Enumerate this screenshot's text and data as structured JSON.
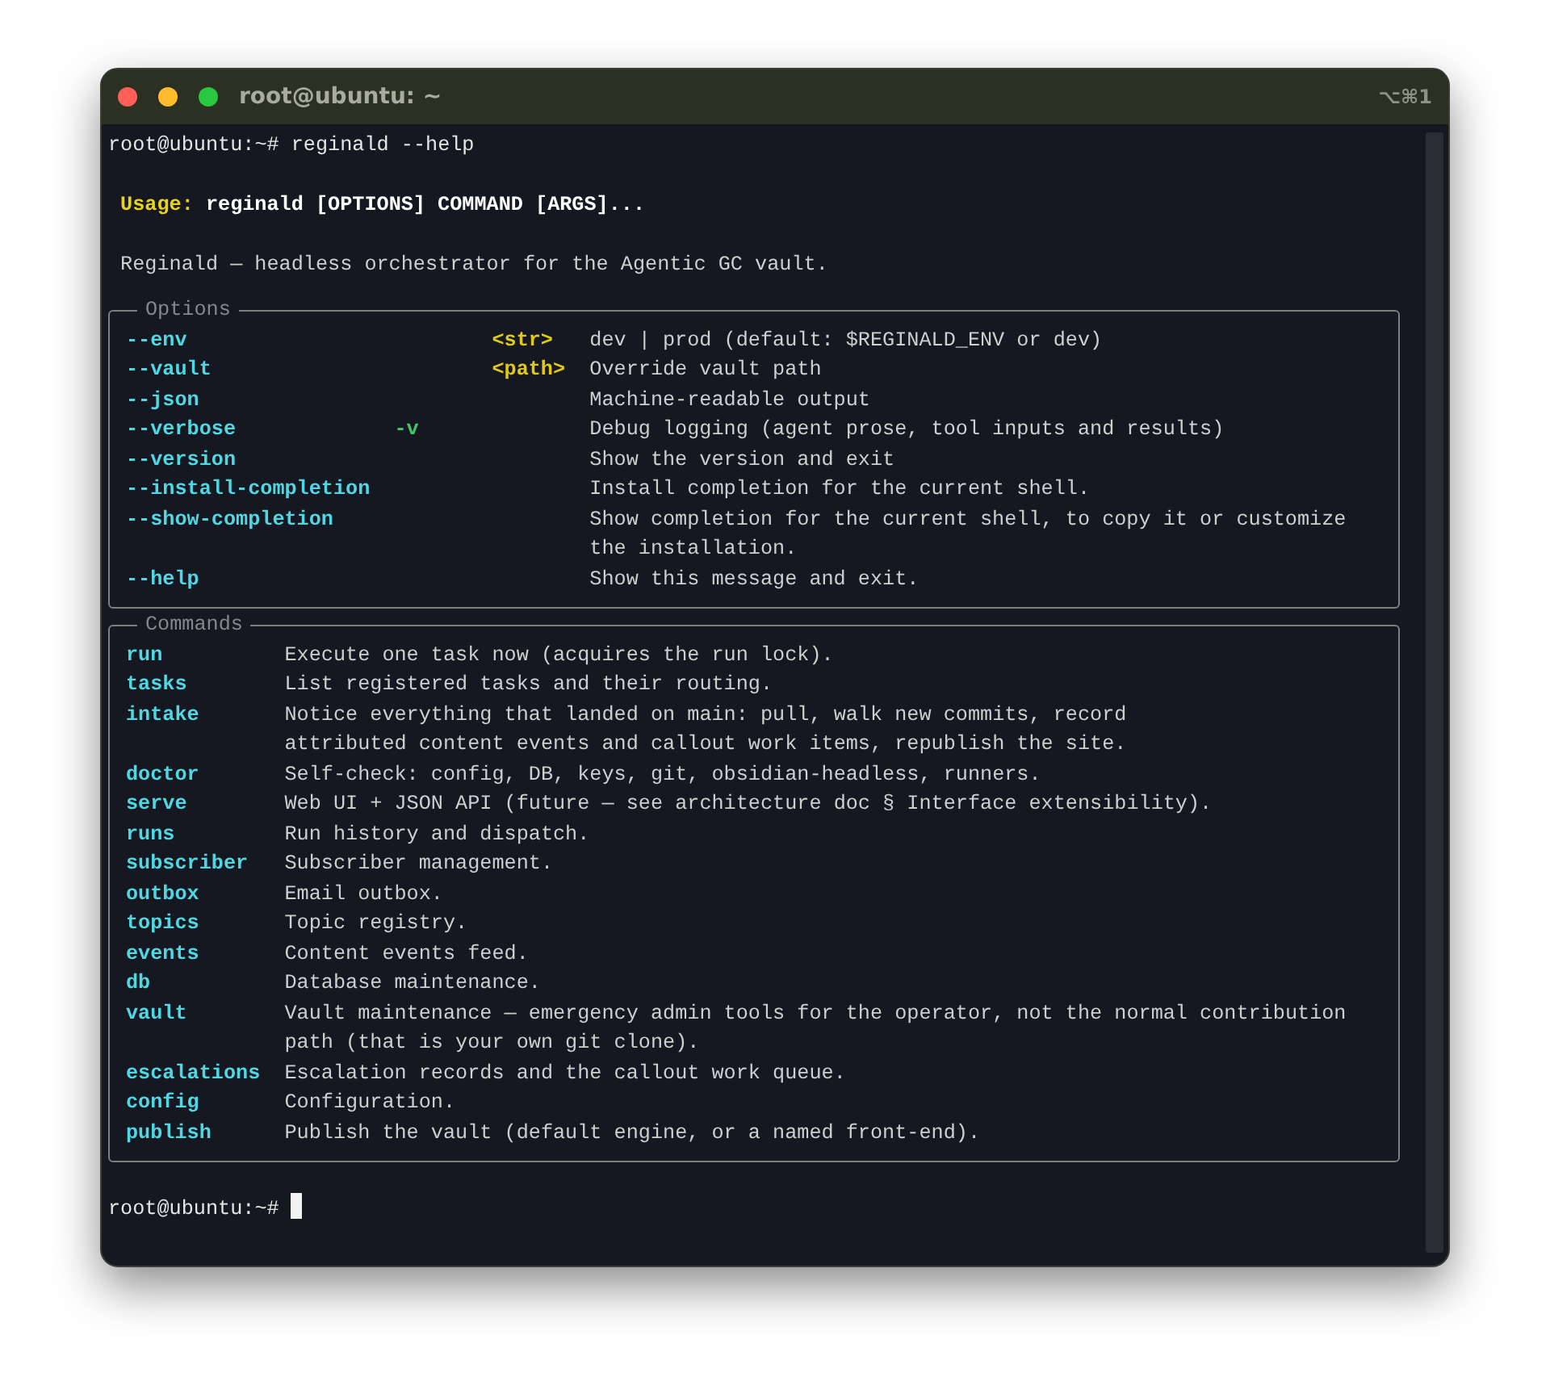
{
  "window": {
    "title": "root@ubuntu: ~",
    "shortcut": "⌥⌘1"
  },
  "terminal": {
    "command_line": {
      "prompt": "root@ubuntu:~#",
      "command": "reginald --help"
    },
    "usage": {
      "label": "Usage:",
      "text": "reginald [OPTIONS] COMMAND [ARGS]..."
    },
    "description": "Reginald — headless orchestrator for the Agentic GC vault.",
    "options_panel": {
      "title": "Options",
      "rows": [
        {
          "name": "--env",
          "metavar": "<str>",
          "description": "dev | prod (default: $REGINALD_ENV or dev)"
        },
        {
          "name": "--vault",
          "metavar": "<path>",
          "description": "Override vault path"
        },
        {
          "name": "--json",
          "description": "Machine-readable output"
        },
        {
          "name": "--verbose",
          "short": "-v",
          "description": "Debug logging (agent prose, tool inputs and results)"
        },
        {
          "name": "--version",
          "description": "Show the version and exit"
        },
        {
          "name": "--install-completion",
          "description": "Install completion for the current shell."
        },
        {
          "name": "--show-completion",
          "description": "Show completion for the current shell, to copy it or customize\nthe installation."
        },
        {
          "name": "--help",
          "description": "Show this message and exit."
        }
      ]
    },
    "commands_panel": {
      "title": "Commands",
      "rows": [
        {
          "name": "run",
          "description": "Execute one task now (acquires the run lock)."
        },
        {
          "name": "tasks",
          "description": "List registered tasks and their routing."
        },
        {
          "name": "intake",
          "description": "Notice everything that landed on main: pull, walk new commits, record\nattributed content events and callout work items, republish the site."
        },
        {
          "name": "doctor",
          "description": "Self-check: config, DB, keys, git, obsidian-headless, runners."
        },
        {
          "name": "serve",
          "description": "Web UI + JSON API (future — see architecture doc § Interface extensibility)."
        },
        {
          "name": "runs",
          "description": "Run history and dispatch."
        },
        {
          "name": "subscriber",
          "description": "Subscriber management."
        },
        {
          "name": "outbox",
          "description": "Email outbox."
        },
        {
          "name": "topics",
          "description": "Topic registry."
        },
        {
          "name": "events",
          "description": "Content events feed."
        },
        {
          "name": "db",
          "description": "Database maintenance."
        },
        {
          "name": "vault",
          "description": "Vault maintenance — emergency admin tools for the operator, not the normal contribution\npath (that is your own git clone)."
        },
        {
          "name": "escalations",
          "description": "Escalation records and the callout work queue."
        },
        {
          "name": "config",
          "description": "Configuration."
        },
        {
          "name": "publish",
          "description": "Publish the vault (default engine, or a named front-end)."
        }
      ]
    },
    "final_prompt": {
      "prompt": "root@ubuntu:~#"
    }
  }
}
